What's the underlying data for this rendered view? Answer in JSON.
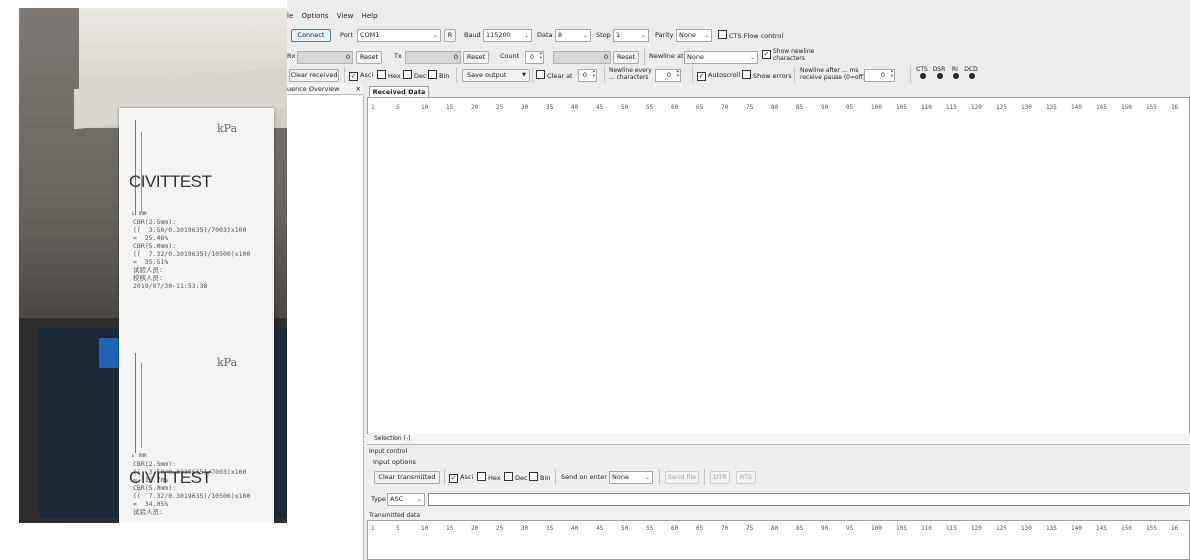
{
  "photo": {
    "receipt_top": {
      "unit": "kPa",
      "brand": "CIVITTEST",
      "axis_mark": "↓ mm",
      "lines": [
        "CBR(2.5mm):",
        "((  3.50/0.3019635)/7003)x100",
        "=  25.46%",
        "CBR(5.0mm):",
        "((  7.32/0.3019635)/10500)x100",
        "=  35.51%",
        "试验人员:",
        "校核人员:",
        "2019/07/30-11:53:38"
      ]
    },
    "receipt_bottom": {
      "unit": "kPa",
      "brand": "CIVITTEST",
      "axis_mark": "↓ mm",
      "lines": [
        "CBR(2.5mm):",
        "((  3.50/0.3019635)/7003)x100",
        "=  16.70%",
        "CBR(5.0mm):",
        "((  7.32/0.3019635)/10500)x100",
        "=  34.05%",
        "试验人员:"
      ]
    }
  },
  "app": {
    "menu": [
      "le",
      "Options",
      "View",
      "Help"
    ],
    "toolbar1": {
      "connect": "Connect",
      "port_label": "Port",
      "port_value": "COM1",
      "r_button": "R",
      "baud_label": "Baud",
      "baud_value": "115200",
      "data_label": "Data",
      "data_value": "8",
      "stop_label": "Stop",
      "stop_value": "1",
      "parity_label": "Parity",
      "parity_value": "None",
      "cts_flow": "CTS Flow control"
    },
    "toolbar2": {
      "rx_label": "Rx",
      "rx_value": "0",
      "reset": "Reset",
      "tx_label": "Tx",
      "tx_value": "0",
      "count_label": "Count",
      "count_value": "0",
      "count_total": "0",
      "newline_at_label": "Newline at",
      "newline_at_value": "None",
      "show_newline": "Show newline\ncharacters"
    },
    "toolbar3": {
      "clear_received": "Clear received",
      "ascii": "Asci",
      "hex": "Hex",
      "dec": "Dec",
      "bin": "Bin",
      "save_output": "Save output",
      "clear_at": "Clear at",
      "clear_at_value": "0",
      "newline_every": "Newline every\n... characters",
      "newline_every_value": "0",
      "autoscroll": "Autoscroll",
      "show_errors": "Show errors",
      "newline_after": "Newline after ... ms\nreceive pause (0=off)",
      "newline_after_value": "0",
      "signals": [
        "CTS",
        "DSR",
        "RI",
        "DCD"
      ]
    },
    "sequence_overview": {
      "title": "uence Overview",
      "close": "✕"
    },
    "received": {
      "tab": "Received Data",
      "ruler": [
        "1",
        "5",
        "10",
        "15",
        "20",
        "25",
        "30",
        "35",
        "40",
        "45",
        "50",
        "55",
        "60",
        "65",
        "70",
        "75",
        "80",
        "85",
        "90",
        "95",
        "100",
        "105",
        "110",
        "115",
        "120",
        "125",
        "130",
        "135",
        "140",
        "145",
        "150",
        "155",
        "16"
      ],
      "selection": "Selection (-)"
    },
    "input_control": {
      "header": "Input control",
      "options": "Input options",
      "clear_transmitted": "Clear transmitted",
      "ascii": "Asci",
      "hex": "Hex",
      "dec": "Dec",
      "bin": "Bin",
      "send_on_enter": "Send on enter",
      "send_on_enter_value": "None",
      "send_file": "Send file",
      "dtr": "DTR",
      "rts": "RTS",
      "type_label": "Type",
      "type_value": "ASC"
    },
    "transmitted": {
      "header": "Transmitted data",
      "ruler": [
        "1",
        "5",
        "10",
        "15",
        "20",
        "25",
        "30",
        "35",
        "40",
        "45",
        "50",
        "55",
        "60",
        "65",
        "70",
        "75",
        "80",
        "85",
        "90",
        "95",
        "100",
        "105",
        "110",
        "115",
        "120",
        "125",
        "130",
        "135",
        "140",
        "145",
        "150",
        "155",
        "16"
      ]
    }
  }
}
